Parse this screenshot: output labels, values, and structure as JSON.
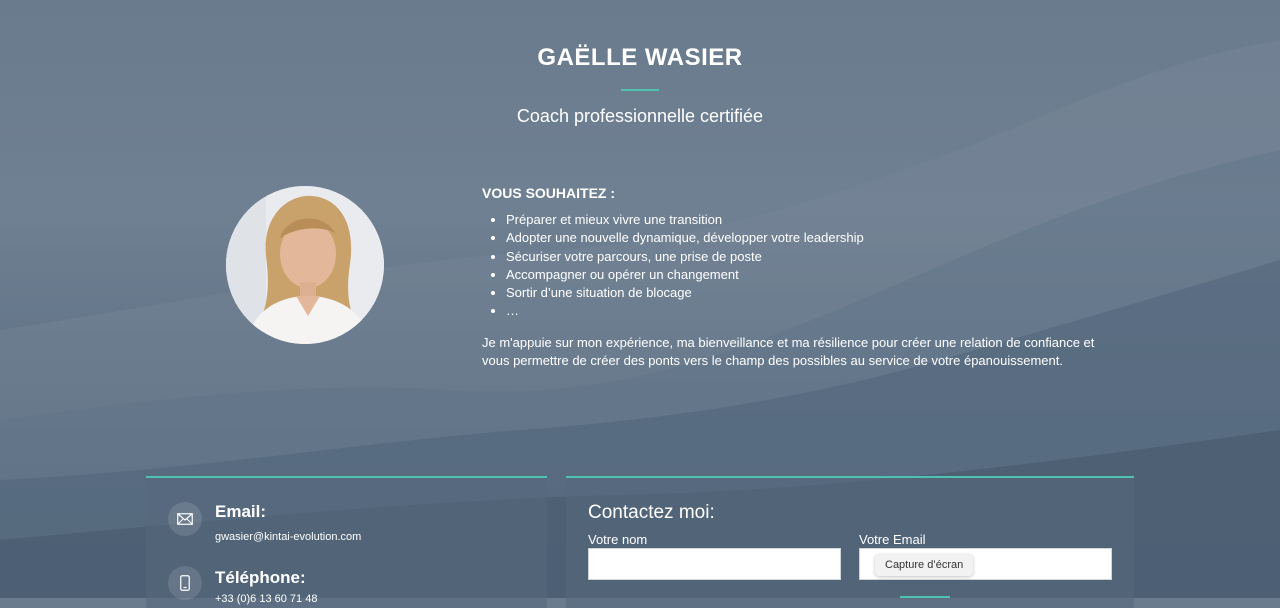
{
  "header": {
    "name": "GAËLLE WASIER",
    "subtitle": "Coach professionnelle certifiée"
  },
  "intro": {
    "heading": "VOUS SOUHAITEZ :",
    "items": [
      "Préparer et mieux vivre une transition",
      "Adopter une nouvelle dynamique, développer votre leadership",
      "Sécuriser votre parcours, une prise de poste",
      "Accompagner ou opérer un changement",
      "Sortir d’une situation de blocage",
      "…"
    ],
    "paragraph": "Je m'appuie sur mon expérience, ma bienveillance et ma résilience pour créer une relation de confiance et vous permettre de créer des ponts vers le champ des possibles au service de votre épanouissement."
  },
  "contact_info": {
    "email_title": "Email:",
    "email_value": "gwasier@kintai-evolution.com",
    "phone_title": "Téléphone:",
    "phone_value": "+33 (0)6 13 60 71 48"
  },
  "contact_form": {
    "title": "Contactez moi:",
    "name_label": "Votre nom",
    "name_value": "",
    "email_label": "Votre Email",
    "email_value": ""
  },
  "tooltip": {
    "text": "Capture d’écran"
  },
  "colors": {
    "accent": "#4fc1b0",
    "background": "#6b7b8e"
  }
}
